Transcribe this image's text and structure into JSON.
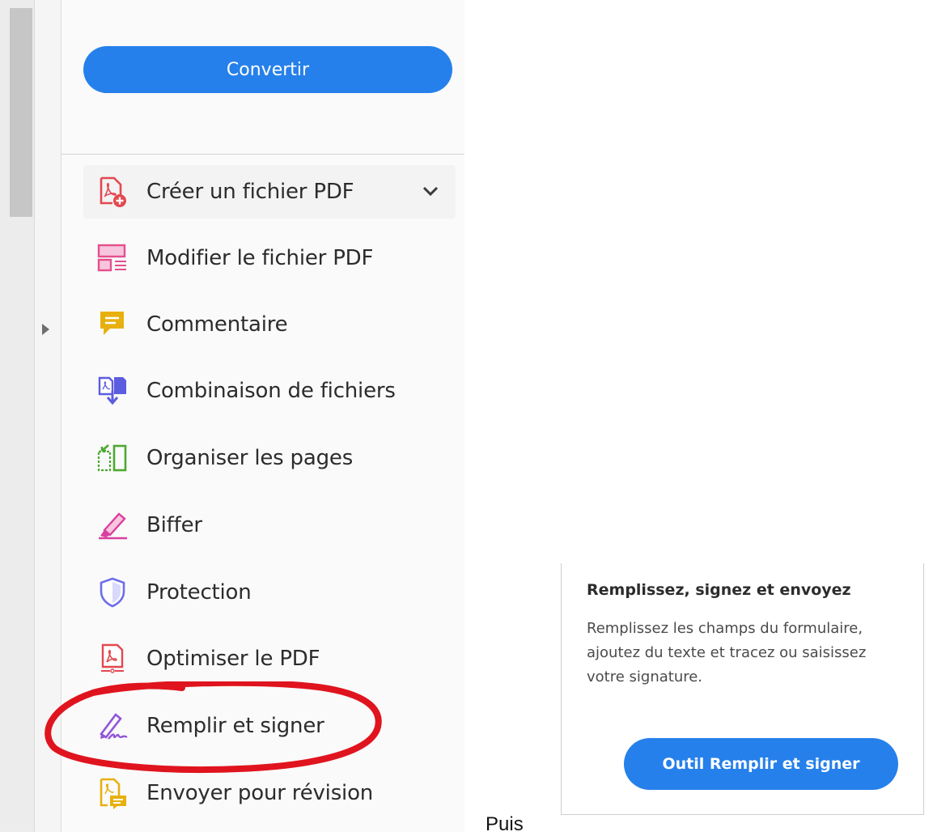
{
  "panel": {
    "convert_label": "Convertir",
    "tools": [
      {
        "label": "Créer un fichier PDF",
        "icon": "create-pdf-icon",
        "color": "#e34850"
      },
      {
        "label": "Modifier le fichier PDF",
        "icon": "edit-pdf-icon",
        "color": "#e34f8e"
      },
      {
        "label": "Commentaire",
        "icon": "comment-icon",
        "color": "#e8b00f"
      },
      {
        "label": "Combinaison de fichiers",
        "icon": "combine-files-icon",
        "color": "#5c5ce0"
      },
      {
        "label": "Organiser les pages",
        "icon": "organize-pages-icon",
        "color": "#4fa832"
      },
      {
        "label": "Biffer",
        "icon": "redact-icon",
        "color": "#d8409f"
      },
      {
        "label": "Protection",
        "icon": "shield-icon",
        "color": "#6e6ee8"
      },
      {
        "label": "Optimiser le PDF",
        "icon": "optimize-pdf-icon",
        "color": "#e34850"
      },
      {
        "label": "Remplir et signer",
        "icon": "fill-sign-icon",
        "color": "#9256d9"
      },
      {
        "label": "Envoyer pour révision",
        "icon": "send-review-icon",
        "color": "#e8b00f"
      }
    ]
  },
  "separator_text": "Puis",
  "card": {
    "title": "Remplissez, signez et envoyez",
    "description": "Remplissez les champs du formulaire, ajoutez du texte et tracez ou saisissez votre signature.",
    "button_label": "Outil Remplir et signer"
  },
  "colors": {
    "accent": "#2680eb",
    "annotation": "#e0141e"
  }
}
